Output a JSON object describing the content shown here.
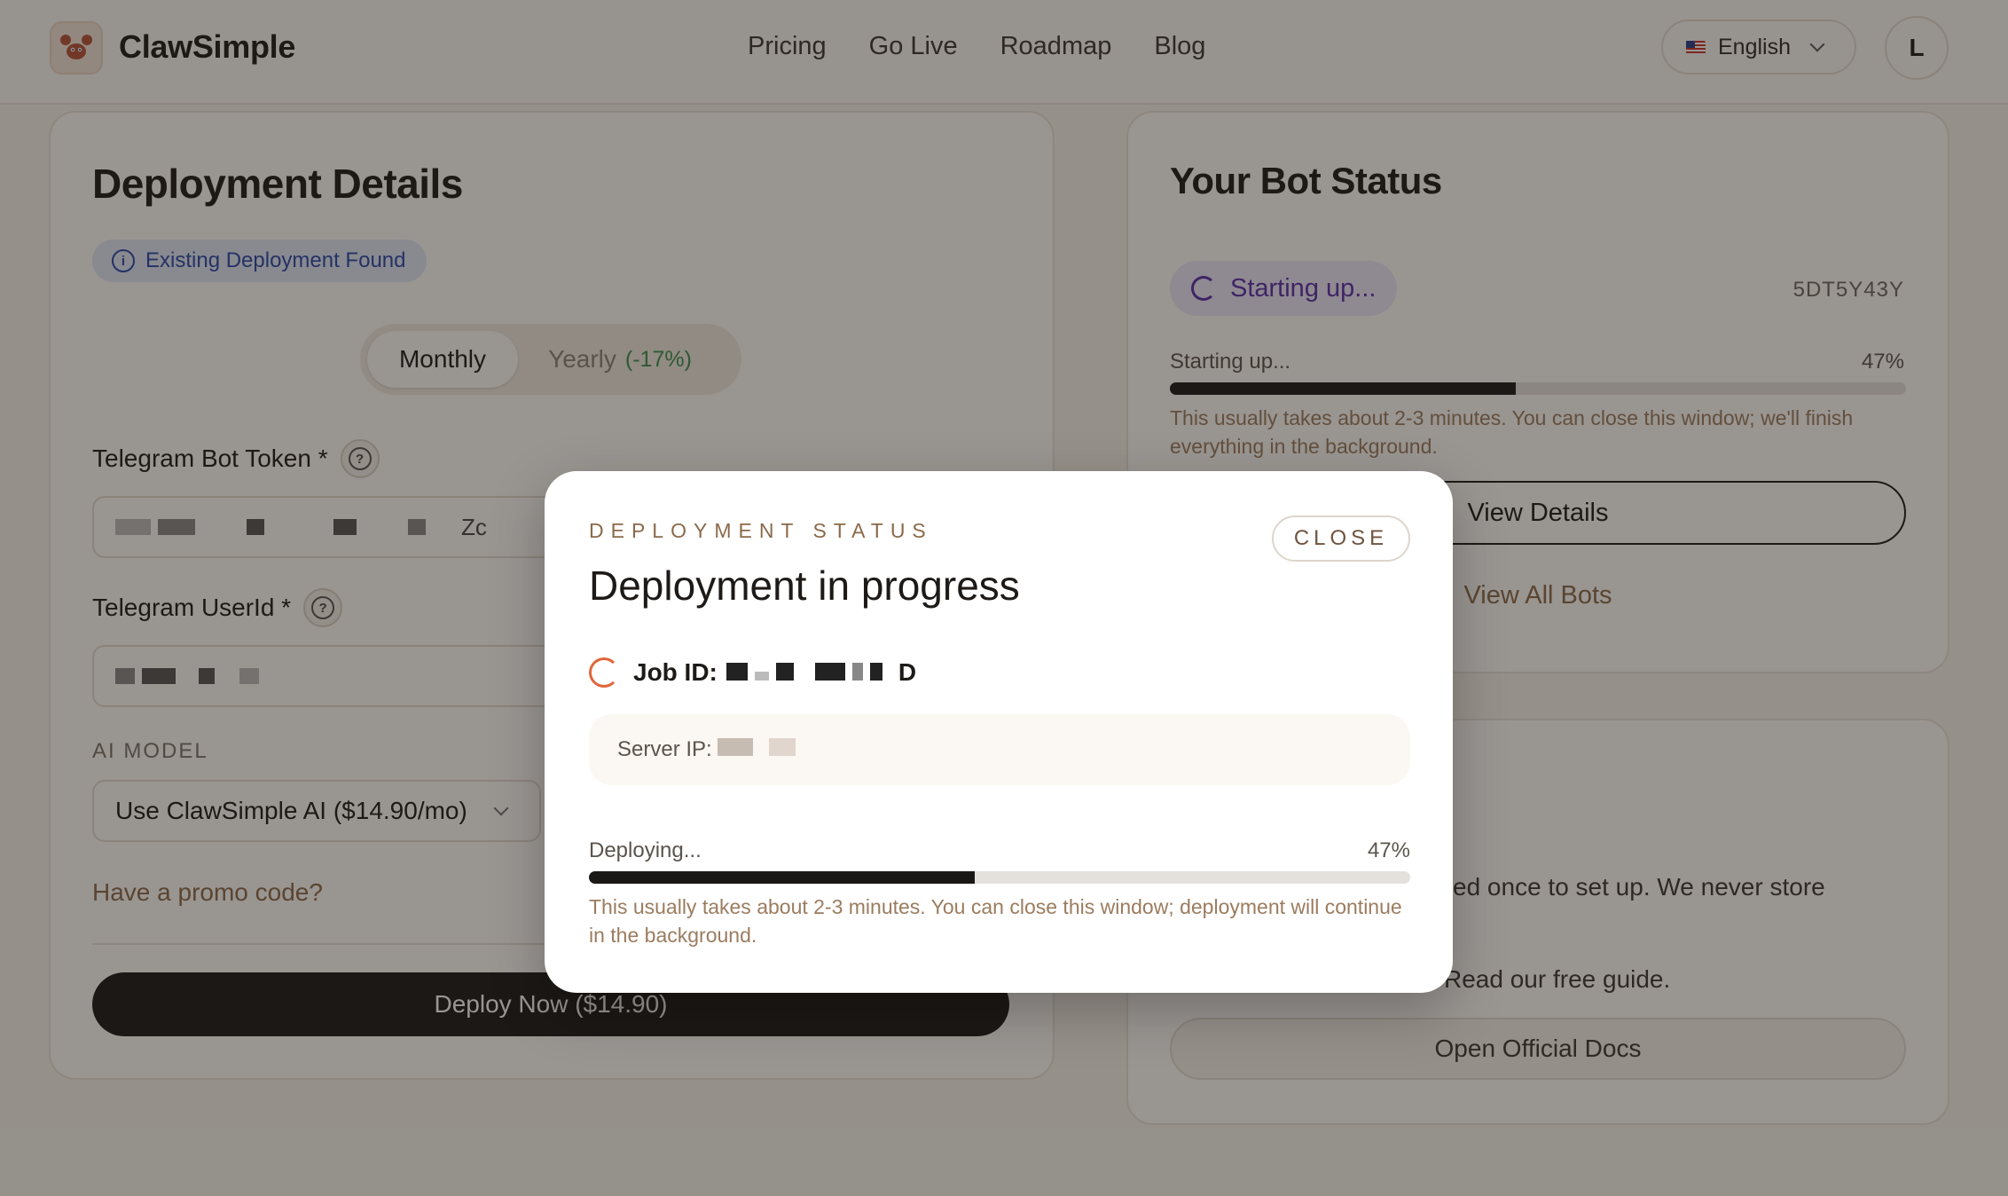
{
  "header": {
    "brand": "ClawSimple",
    "nav": [
      "Pricing",
      "Go Live",
      "Roadmap",
      "Blog"
    ],
    "language": "English",
    "avatar_initial": "L"
  },
  "deployment": {
    "title": "Deployment Details",
    "existing_badge": "Existing Deployment Found",
    "billing": {
      "monthly": "Monthly",
      "yearly": "Yearly",
      "yearly_discount": "(-17%)"
    },
    "token_label": "Telegram Bot Token *",
    "token_visible_fragment": "Zc",
    "userid_label": "Telegram UserId *",
    "ai_model_label": "AI MODEL",
    "ai_model_value": "Use ClawSimple AI ($14.90/mo)",
    "promo_link": "Have a promo code?",
    "deploy_button": "Deploy Now ($14.90)"
  },
  "bot_status": {
    "title": "Your Bot Status",
    "status_pill": "Starting up...",
    "bot_id": "5DT5Y43Y",
    "progress_label": "Starting up...",
    "progress_percent_text": "47%",
    "progress": 0.47,
    "note": "This usually takes about 2-3 minutes. You can close this window; we'll finish everything in the background.",
    "view_details": "View Details",
    "view_all_bots": "View All Bots"
  },
  "help_card": {
    "text1": "ed once to set up. We never store",
    "text2": "Read our free guide.",
    "docs_button": "Open Official Docs"
  },
  "modal": {
    "eyebrow": "DEPLOYMENT STATUS",
    "title": "Deployment in progress",
    "close": "CLOSE",
    "job_label": "Job ID:",
    "job_visible_suffix": "D",
    "server_ip_label": "Server IP:",
    "progress_label": "Deploying...",
    "progress_percent_text": "47%",
    "progress": 0.47,
    "note": "This usually takes about 2-3 minutes. You can close this window; deployment will continue in the background."
  },
  "colors": {
    "accent_orange": "#e0663a",
    "status_purple": "#5a2fa8",
    "info_blue": "#2a47a8",
    "discount_green": "#3c8f4d",
    "muted_brown": "#8b6a4a"
  }
}
